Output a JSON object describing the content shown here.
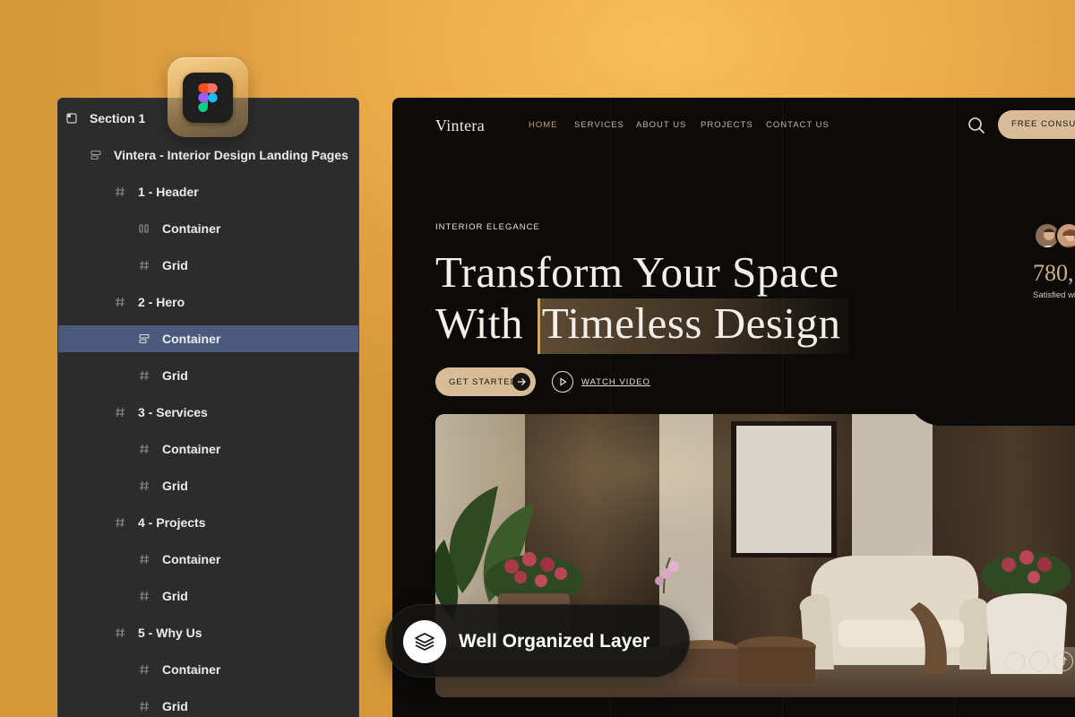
{
  "layers": {
    "items": [
      {
        "label": "Section 1",
        "icon": "section-icon",
        "depth": 0
      },
      {
        "label": "Vintera - Interior Design Landing Pages",
        "icon": "frame-icon",
        "depth": 1
      },
      {
        "label": "1 - Header",
        "icon": "hash-icon",
        "depth": 2
      },
      {
        "label": "Container",
        "icon": "autolayout-horizontal-icon",
        "depth": 3
      },
      {
        "label": "Grid",
        "icon": "hash-icon",
        "depth": 3
      },
      {
        "label": "2 - Hero",
        "icon": "hash-icon",
        "depth": 2
      },
      {
        "label": "Container",
        "icon": "autolayout-vertical-icon",
        "depth": 3,
        "selected": true
      },
      {
        "label": "Grid",
        "icon": "hash-icon",
        "depth": 3
      },
      {
        "label": "3 - Services",
        "icon": "hash-icon",
        "depth": 2
      },
      {
        "label": "Container",
        "icon": "hash-icon",
        "depth": 3
      },
      {
        "label": "Grid",
        "icon": "hash-icon",
        "depth": 3
      },
      {
        "label": "4 - Projects",
        "icon": "hash-icon",
        "depth": 2
      },
      {
        "label": "Container",
        "icon": "hash-icon",
        "depth": 3
      },
      {
        "label": "Grid",
        "icon": "hash-icon",
        "depth": 3
      },
      {
        "label": "5 - Why Us",
        "icon": "hash-icon",
        "depth": 2
      },
      {
        "label": "Container",
        "icon": "hash-icon",
        "depth": 3
      },
      {
        "label": "Grid",
        "icon": "hash-icon",
        "depth": 3
      }
    ]
  },
  "figma_badge": {
    "icon": "figma-logo-icon"
  },
  "site": {
    "logo": "Vintera",
    "nav": [
      {
        "label": "HOME",
        "active": true
      },
      {
        "label": "SERVICES"
      },
      {
        "label": "ABOUT US"
      },
      {
        "label": "PROJECTS"
      },
      {
        "label": "CONTACT US"
      }
    ],
    "cta_label": "FREE CONSULTATION",
    "hero": {
      "eyebrow": "INTERIOR ELEGANCE",
      "headline_line1": "Transform Your Space",
      "headline_line2_prefix": "With",
      "headline_line2_highlight": "Timeless Design",
      "primary_button": "GET STARTED",
      "secondary_link": "WATCH VIDEO"
    },
    "stats": {
      "number": "780,",
      "label": "Satisfied wi"
    },
    "colors": {
      "accent": "#d8bc97",
      "background": "#0c0b0a"
    }
  },
  "badge": {
    "label": "Well Organized Layer",
    "icon": "layers-icon"
  }
}
